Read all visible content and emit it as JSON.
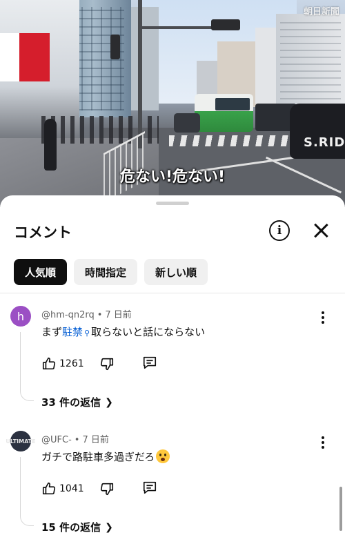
{
  "video": {
    "subtitle": "危ない!危ない!",
    "watermark": "朝日新聞",
    "taxi_text": "S.RIDE"
  },
  "sheet": {
    "title": "コメント",
    "info_icon": "info-icon",
    "close_icon": "close-icon"
  },
  "chips": [
    {
      "label": "人気順",
      "active": true
    },
    {
      "label": "時間指定",
      "active": false
    },
    {
      "label": "新しい順",
      "active": false
    }
  ],
  "comments": [
    {
      "avatar_letter": "h",
      "avatar_color": "#9b4fc4",
      "author": "@hm-qn2rq",
      "time": "7 日前",
      "text_before": "まず",
      "text_link": "駐禁",
      "text_after": "取らないと話にならない",
      "likes": "1261",
      "replies": "33 件の返信"
    },
    {
      "avatar_letter": "ULTIMATE",
      "author": "@UFC-",
      "time": "7 日前",
      "text": "ガチで路駐車多過ぎだろ",
      "emoji": "astonished-face-emoji",
      "likes": "1041",
      "replies": "15 件の返信"
    }
  ],
  "colors": {
    "link": "#065fd4",
    "chip_active_bg": "#0f0f0f",
    "chip_bg": "#f0f0f0"
  }
}
